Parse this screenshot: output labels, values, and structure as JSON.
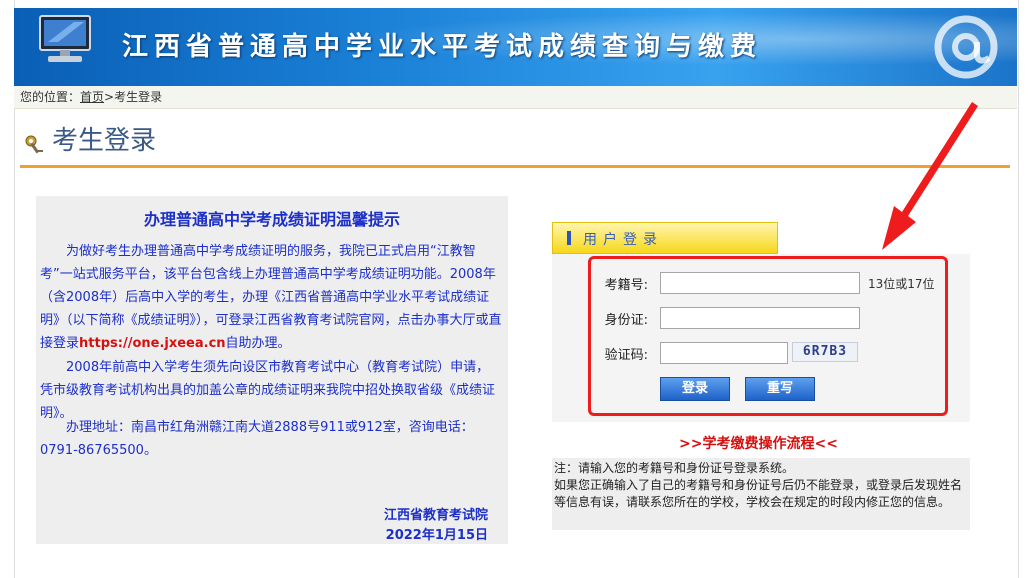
{
  "banner": {
    "title": "江西省普通高中学业水平考试成绩查询与缴费"
  },
  "breadcrumb": {
    "label": "您的位置：",
    "home": "首页",
    "separator": " > ",
    "current": "考生登录"
  },
  "page_title": "考生登录",
  "notice": {
    "title": "办理普通高中学考成绩证明温馨提示",
    "p1": "为做好考生办理普通高中学考成绩证明的服务，我院已正式启用“江教智考”一站式服务平台，该平台包含线上办理普通高中学考成绩证明功能。2008年（含2008年）后高中入学的考生，办理《江西省普通高中学业水平考试成绩证明》（以下简称《成绩证明》），可登录江西省教育考试院官网，点击办事大厅或直接登录",
    "p1_link": "https://one.jxeea.cn",
    "p1_tail": "自助办理。",
    "p2": "2008年前高中入学考生须先向设区市教育考试中心（教育考试院）申请，凭市级教育考试机构出具的加盖公章的成绩证明来我院中招处换取省级《成绩证明》。",
    "p3": "办理地址：南昌市红角洲赣江南大道2888号911或912室，咨询电话：0791-86765500。",
    "sign_org": "江西省教育考试院",
    "sign_date": "2022年1月15日"
  },
  "login": {
    "tab_label": "用户登录",
    "fields": {
      "exam_id_label": "考籍号:",
      "exam_id_hint": "13位或17位",
      "id_card_label": "身份证:",
      "captcha_label": "验证码:",
      "captcha_code": "6R7B3"
    },
    "login_button": "登录",
    "reset_button": "重写"
  },
  "flow_link": ">>学考缴费操作流程<<",
  "note": "注：请输入您的考籍号和身份证号登录系统。\n如果您正确输入了自己的考籍号和身份证号后仍不能登录，或登录后发现姓名等信息有误，请联系您所在的学校，学校会在规定的时段内修正您的信息。",
  "colors": {
    "banner_blue": "#1a7fd6",
    "accent_orange": "#f0a030",
    "notice_blue": "#1c2fc9",
    "alert_red": "#ee1c1c"
  }
}
